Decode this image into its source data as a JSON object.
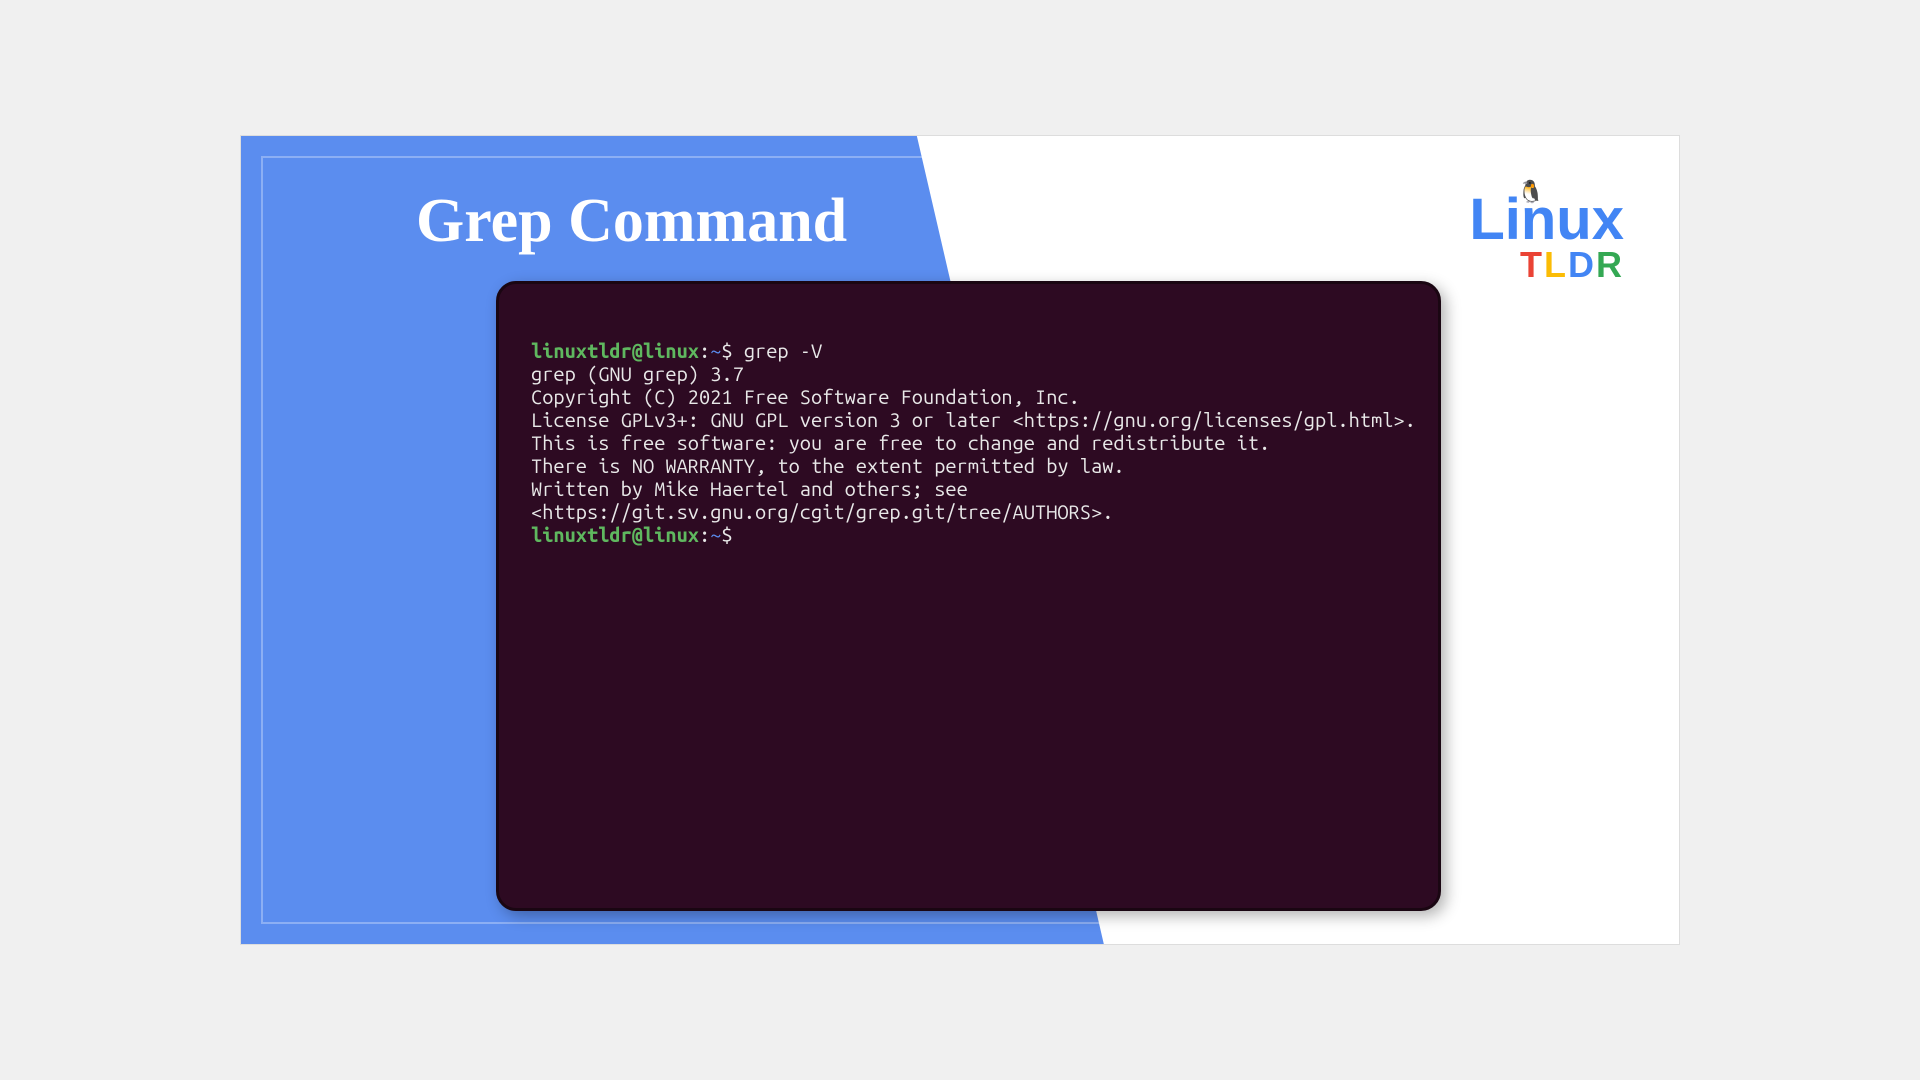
{
  "title": "Grep Command",
  "logo": {
    "main": "Linux",
    "sub_t": "T",
    "sub_l": "L",
    "sub_d": "D",
    "sub_r": "R",
    "penguin": "🐧"
  },
  "terminal": {
    "prompt_user": "linuxtldr@linux",
    "prompt_sep": ":",
    "prompt_path": "~",
    "prompt_dollar": "$ ",
    "command1": "grep -V",
    "output": {
      "line1": "grep (GNU grep) 3.7",
      "line2": "Copyright (C) 2021 Free Software Foundation, Inc.",
      "line3": "License GPLv3+: GNU GPL version 3 or later <https://gnu.org/licenses/gpl.html>.",
      "line4": "This is free software: you are free to change and redistribute it.",
      "line5": "There is NO WARRANTY, to the extent permitted by law.",
      "line6": "",
      "line7": "Written by Mike Haertel and others; see",
      "line8": "<https://git.sv.gnu.org/cgit/grep.git/tree/AUTHORS>."
    }
  }
}
